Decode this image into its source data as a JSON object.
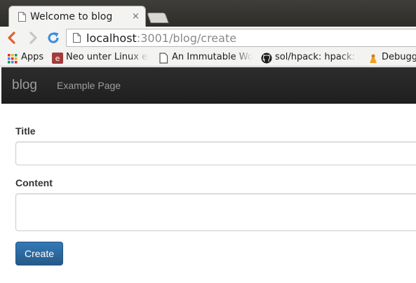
{
  "browser": {
    "tab": {
      "title": "Welcome to blog",
      "close_glyph": "×"
    },
    "address": {
      "host": "localhost",
      "path": ":3001/blog/create"
    },
    "bookmarks": [
      {
        "label": "Apps",
        "icon": "apps-grid-icon"
      },
      {
        "label": "Neo unter Linux einrichten",
        "icon": "bookmark-favicon"
      },
      {
        "label": "An Immutable World",
        "icon": "page-icon"
      },
      {
        "label": "sol/hpack: hpack: An alternative format",
        "icon": "github-icon"
      },
      {
        "label": "Debugging",
        "icon": "bookmark-favicon"
      }
    ]
  },
  "navbar": {
    "brand": "blog",
    "links": [
      "Example Page"
    ]
  },
  "form": {
    "title_label": "Title",
    "title_value": "",
    "content_label": "Content",
    "content_value": "",
    "submit_label": "Create"
  },
  "colors": {
    "navbar_bg": "#222222",
    "navbar_text": "#9d9d9d",
    "primary_button": "#337ab7",
    "reload_icon": "#3b8be0",
    "back_icon": "#e0602c"
  }
}
